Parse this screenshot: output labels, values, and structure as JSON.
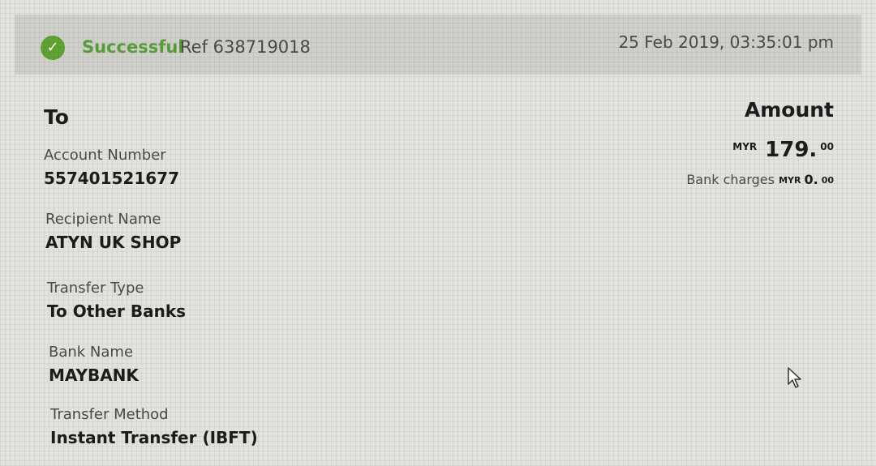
{
  "header": {
    "status": "Successful",
    "reference": "Ref 638719018",
    "timestamp": "25 Feb 2019, 03:35:01 pm",
    "status_icon": "check-circle-icon",
    "status_color": "#5a9e39"
  },
  "recipient": {
    "section_title": "To",
    "fields": [
      {
        "label": "Account Number",
        "value": "557401521677"
      },
      {
        "label": "Recipient Name",
        "value": "ATYN UK SHOP"
      },
      {
        "label": "Transfer Type",
        "value": "To Other Banks"
      },
      {
        "label": "Bank Name",
        "value": "MAYBANK"
      },
      {
        "label": "Transfer Method",
        "value": "Instant Transfer (IBFT)"
      }
    ]
  },
  "amount": {
    "section_title": "Amount",
    "currency": "MYR",
    "value": "179.",
    "cents": "00",
    "bank_charges_label": "Bank charges",
    "bank_charges_currency": "MYR",
    "bank_charges_value": "0.",
    "bank_charges_cents": "00"
  },
  "cursor_icon": "mouse-pointer-icon"
}
